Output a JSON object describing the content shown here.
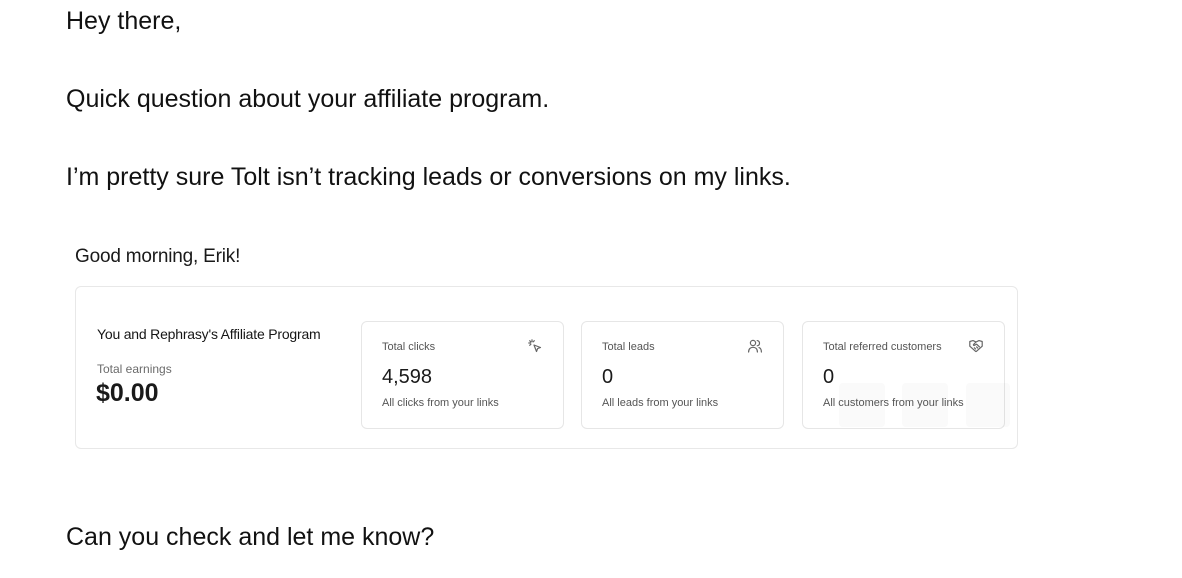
{
  "email": {
    "greeting": "Hey there,",
    "question": "Quick question about your affiliate program.",
    "issue": "I’m pretty sure Tolt isn’t tracking leads or conversions on my links.",
    "closing": "Can you check and let me know?"
  },
  "screenshot": {
    "greeting": "Good morning, Erik!",
    "program_title": "You and Rephrasy's Affiliate Program",
    "earnings_label": "Total earnings",
    "earnings_value": "$0.00",
    "stats": [
      {
        "label": "Total clicks",
        "value": "4,598",
        "description": "All clicks from your links",
        "icon": "sparkle-pointer-icon"
      },
      {
        "label": "Total leads",
        "value": "0",
        "description": "All leads from your links",
        "icon": "users-icon"
      },
      {
        "label": "Total referred customers",
        "value": "0",
        "description": "All customers from your links",
        "icon": "handshake-icon"
      }
    ]
  },
  "colors": {
    "text": "#111111",
    "muted": "#555555",
    "border": "#e6e6e6"
  }
}
